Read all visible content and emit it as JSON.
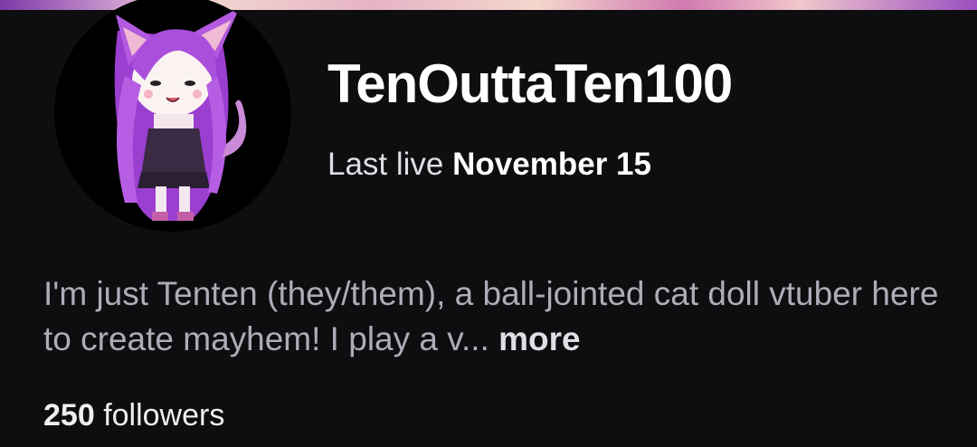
{
  "channel": {
    "username": "TenOuttaTen100",
    "last_live_label": "Last live",
    "last_live_date": "November 15",
    "bio_text": "I'm just Tenten (they/them), a ball-jointed cat doll vtuber here to create mayhem! I play a v...",
    "bio_more_label": "more",
    "followers_count": "250",
    "followers_label": "followers"
  },
  "avatar": {
    "description": "chibi purple-haired cat-girl doll avatar",
    "icon": "avatar-image"
  },
  "colors": {
    "background": "#0e0e10",
    "text_primary": "#ffffff",
    "text_secondary": "#adadb8",
    "hair_purple": "#a855d6"
  }
}
